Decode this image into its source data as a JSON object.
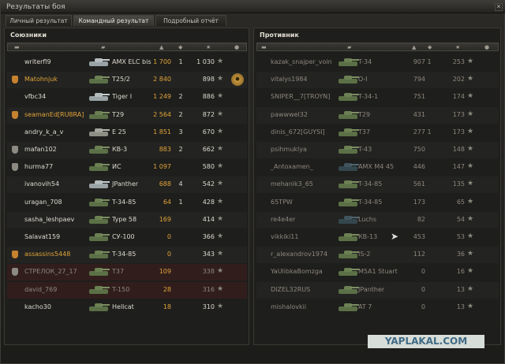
{
  "window": {
    "title": "Результаты боя",
    "close_label": "✕"
  },
  "tabs": [
    {
      "label": "Личный результат",
      "active": false
    },
    {
      "label": "Командный результат",
      "active": true
    },
    {
      "label": "Подробный отчёт",
      "active": false
    }
  ],
  "allies": {
    "title": "Союзники",
    "rows": [
      {
        "player": "writerfl9",
        "vehicle": "AMX ELC bis",
        "damage": "1 700",
        "kills": "1",
        "xp": "1 030",
        "badge": "",
        "tank_style": "light",
        "medal": false,
        "state": ""
      },
      {
        "player": "Matohnjuk",
        "vehicle": "T25/2",
        "damage": "2 840",
        "kills": "",
        "xp": "898",
        "badge": "gold",
        "tank_style": "green",
        "medal": true,
        "state": "gold"
      },
      {
        "player": "vfbc34",
        "vehicle": "Tiger I",
        "damage": "1 249",
        "kills": "2",
        "xp": "886",
        "badge": "",
        "tank_style": "light",
        "medal": false,
        "state": ""
      },
      {
        "player": "seamanEd[RU8RA]",
        "vehicle": "T29",
        "damage": "2 564",
        "kills": "2",
        "xp": "872",
        "badge": "gold",
        "tank_style": "green",
        "medal": false,
        "state": "gold"
      },
      {
        "player": "andry_k_a_v",
        "vehicle": "E 25",
        "damage": "1 851",
        "kills": "3",
        "xp": "670",
        "badge": "",
        "tank_style": "",
        "medal": false,
        "state": ""
      },
      {
        "player": "mafan102",
        "vehicle": "КВ-3",
        "damage": "883",
        "kills": "2",
        "xp": "662",
        "badge": "grey",
        "tank_style": "green",
        "medal": false,
        "state": ""
      },
      {
        "player": "hurma77",
        "vehicle": "ИС",
        "damage": "1 097",
        "kills": "",
        "xp": "580",
        "badge": "grey",
        "tank_style": "green",
        "medal": false,
        "state": ""
      },
      {
        "player": "ivanovih54",
        "vehicle": "JPanther",
        "damage": "688",
        "kills": "4",
        "xp": "542",
        "badge": "",
        "tank_style": "light",
        "medal": false,
        "state": ""
      },
      {
        "player": "uragan_708",
        "vehicle": "T-34-85",
        "damage": "64",
        "kills": "1",
        "xp": "428",
        "badge": "",
        "tank_style": "green",
        "medal": false,
        "state": ""
      },
      {
        "player": "sasha_leshpaev",
        "vehicle": "Type 58",
        "damage": "169",
        "kills": "",
        "xp": "414",
        "badge": "",
        "tank_style": "green",
        "medal": false,
        "state": ""
      },
      {
        "player": "Salavat159",
        "vehicle": "СУ-100",
        "damage": "0",
        "kills": "",
        "xp": "366",
        "badge": "",
        "tank_style": "green",
        "medal": false,
        "state": ""
      },
      {
        "player": "assassins5448",
        "vehicle": "T-34-85",
        "damage": "0",
        "kills": "",
        "xp": "343",
        "badge": "gold",
        "tank_style": "green",
        "medal": false,
        "state": "gold"
      },
      {
        "player": "СТРЕЛОК_27_17",
        "vehicle": "T37",
        "damage": "109",
        "kills": "",
        "xp": "338",
        "badge": "grey",
        "tank_style": "green",
        "medal": false,
        "state": "dead"
      },
      {
        "player": "david_769",
        "vehicle": "T-150",
        "damage": "28",
        "kills": "",
        "xp": "316",
        "badge": "",
        "tank_style": "green",
        "medal": false,
        "state": "dead"
      },
      {
        "player": "kacho30",
        "vehicle": "Hellcat",
        "damage": "18",
        "kills": "",
        "xp": "310",
        "badge": "",
        "tank_style": "green",
        "medal": false,
        "state": ""
      }
    ]
  },
  "enemies": {
    "title": "Противник",
    "rows": [
      {
        "player": "kazak_snajper_voin",
        "vehicle": "T-34",
        "damage": "907",
        "kills": "1",
        "xp": "253",
        "tank_style": "green",
        "state": "right-dead"
      },
      {
        "player": "vitalys1984",
        "vehicle": "О-I",
        "damage": "794",
        "kills": "",
        "xp": "202",
        "tank_style": "green",
        "state": "right-dead"
      },
      {
        "player": "SNIPER__7[TROYN]",
        "vehicle": "T-34-1",
        "damage": "751",
        "kills": "",
        "xp": "174",
        "tank_style": "green",
        "state": "right-dead"
      },
      {
        "player": "pawwwel32",
        "vehicle": "T29",
        "damage": "431",
        "kills": "",
        "xp": "173",
        "tank_style": "green",
        "state": "right-dead"
      },
      {
        "player": "dinis_672[GUYSI]",
        "vehicle": "T37",
        "damage": "277",
        "kills": "1",
        "xp": "173",
        "tank_style": "green",
        "state": "right-dead"
      },
      {
        "player": "psihmuklya",
        "vehicle": "T-43",
        "damage": "750",
        "kills": "",
        "xp": "148",
        "tank_style": "green",
        "state": "right-dead"
      },
      {
        "player": "_Antoxamen_",
        "vehicle": "AMX M4 45",
        "damage": "446",
        "kills": "",
        "xp": "147",
        "tank_style": "dark",
        "state": "right-dead"
      },
      {
        "player": "mehanik3_65",
        "vehicle": "T-34-85",
        "damage": "561",
        "kills": "",
        "xp": "135",
        "tank_style": "green",
        "state": "right-dead"
      },
      {
        "player": "65TPW",
        "vehicle": "T-34-85",
        "damage": "173",
        "kills": "",
        "xp": "65",
        "tank_style": "green",
        "state": "right-dead"
      },
      {
        "player": "re4e4er",
        "vehicle": "Luchs",
        "damage": "82",
        "kills": "",
        "xp": "54",
        "tank_style": "dark",
        "state": "right-dead"
      },
      {
        "player": "vikkiki11",
        "vehicle": "КВ-13",
        "damage": "453",
        "kills": "",
        "xp": "53",
        "tank_style": "green",
        "state": "right-dead"
      },
      {
        "player": "r_alexandrov1974",
        "vehicle": "IS-2",
        "damage": "112",
        "kills": "",
        "xp": "36",
        "tank_style": "green",
        "state": "right-dead"
      },
      {
        "player": "YaUlibkaBomzga",
        "vehicle": "M5A1 Stuart",
        "damage": "0",
        "kills": "",
        "xp": "16",
        "tank_style": "green",
        "state": "right-dead"
      },
      {
        "player": "DIZEL32RUS",
        "vehicle": "JPanther",
        "damage": "0",
        "kills": "",
        "xp": "13",
        "tank_style": "green",
        "state": "right-dead"
      },
      {
        "player": "mishalovkii",
        "vehicle": "AT 7",
        "damage": "0",
        "kills": "",
        "xp": "13",
        "tank_style": "green",
        "state": "right-dead"
      }
    ]
  },
  "watermark": "YAPLAKAL.COM"
}
